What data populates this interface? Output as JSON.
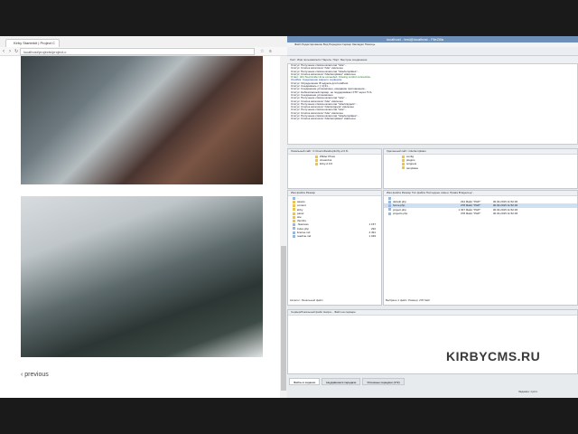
{
  "browser": {
    "tab_title": "Kirby Starterkit | Project C",
    "url": "localhost/projects/project-c",
    "previous_link": "‹ previous"
  },
  "filezilla": {
    "title": "localhost - test@localhost - FileZilla",
    "menu": "Файл   Редактирование   Вид   Передача   Сервер   Закладки   Помощь",
    "quickconnect": "Хост:          Имя пользователя:          Пароль:          Порт:          Быстрое соединение",
    "log": [
      {
        "t": "Статус:   Получение списка каталогов \"/site\"...",
        "c": ""
      },
      {
        "t": "Статус:   Список каталогов \"/site\" извлечен",
        "c": ""
      },
      {
        "t": "Статус:   Получение списка каталогов \"/site/templates\"...",
        "c": ""
      },
      {
        "t": "Статус:   Список каталогов \"/site/templates\" извлечен",
        "c": ""
      },
      {
        "t": "Ответ:   421 No-transfer-time exceeded. Closing control connection.",
        "c": "g"
      },
      {
        "t": "Ошибка:   Соединение закрыто сервером",
        "c": "b"
      },
      {
        "t": "Статус:   Определение IP-адреса для localhost",
        "c": ""
      },
      {
        "t": "Статус:   Соединяюсь с [::1]:21...",
        "c": ""
      },
      {
        "t": "Статус:   Соединение установлено, ожидание приглашения...",
        "c": ""
      },
      {
        "t": "Статус:   Небезопасный сервер, не поддерживает FTP через TLS.",
        "c": ""
      },
      {
        "t": "Статус:   Соединение установлено",
        "c": ""
      },
      {
        "t": "Статус:   Получение списка каталогов \"/site\"...",
        "c": ""
      },
      {
        "t": "Статус:   Список каталогов \"/site\" извлечен",
        "c": ""
      },
      {
        "t": "Статус:   Получение списка каталогов \"/site/snippets\"...",
        "c": ""
      },
      {
        "t": "Статус:   Список каталогов \"/site/snippets\" извлечен",
        "c": ""
      },
      {
        "t": "Статус:   Получение списка каталогов \"/site\"...",
        "c": ""
      },
      {
        "t": "Статус:   Список каталогов \"/site\" извлечен",
        "c": ""
      },
      {
        "t": "Статус:   Получение списка каталогов \"/site/templates\"...",
        "c": ""
      },
      {
        "t": "Статус:   Список каталогов \"/site/templates\" извлечен",
        "c": ""
      }
    ],
    "local_path": "Локальный сайт:  C:\\Users\\Desktop\\kirby-2.0.6\\",
    "remote_path": "Удаленный сайт:  /site/templates",
    "local_tree": [
      "Wilder Photo",
      "xtreambot",
      "kirby-2.0.6"
    ],
    "remote_tree": [
      "config",
      "plugins",
      "snippets",
      "templates"
    ],
    "local_header": "Имя файла                    Размер",
    "remote_header": "Имя файла        Размер   Тип файла    Последнее измен.   Права    Владелец/...",
    "local_files": [
      {
        "name": "..",
        "size": ""
      },
      {
        "name": "assets",
        "size": ""
      },
      {
        "name": "content",
        "size": ""
      },
      {
        "name": "kirby",
        "size": ""
      },
      {
        "name": "panel",
        "size": ""
      },
      {
        "name": "site",
        "size": ""
      },
      {
        "name": "thumbs",
        "size": ""
      },
      {
        "name": ".htaccess",
        "size": "1 157"
      },
      {
        "name": "index.php",
        "size": "292"
      },
      {
        "name": "license.md",
        "size": "4 491"
      },
      {
        "name": "readme.md",
        "size": "1 049"
      }
    ],
    "remote_files": [
      {
        "name": "..",
        "size": "",
        "type": "",
        "date": ""
      },
      {
        "name": "default.php",
        "size": "234",
        "type": "Файл \"PHP\"",
        "date": "30.03.2015 11:52:36"
      },
      {
        "name": "home.php",
        "size": "278",
        "type": "Файл \"PHP\"",
        "date": "30.03.2015 11:52:36"
      },
      {
        "name": "project.php",
        "size": "1 037",
        "type": "Файл \"PHP\"",
        "date": "30.03.2015 11:52:36"
      },
      {
        "name": "projects.php",
        "size": "378",
        "type": "Файл \"PHP\"",
        "date": "30.03.2015 11:52:36"
      }
    ],
    "local_status": "Каталог: Локальный файл",
    "remote_status": "Выбрано 1 файл. Размер: 278 байт",
    "queue_header": "Сервер/Локальный файл                                         Напра...   Файл на сервере",
    "queue_tabs": [
      "Файлы в задании",
      "Неудавшиеся передачи",
      "Успешные передачи (172)"
    ],
    "queue_status": "Задание: пусто"
  },
  "watermark": "KIRBYCMS.RU"
}
